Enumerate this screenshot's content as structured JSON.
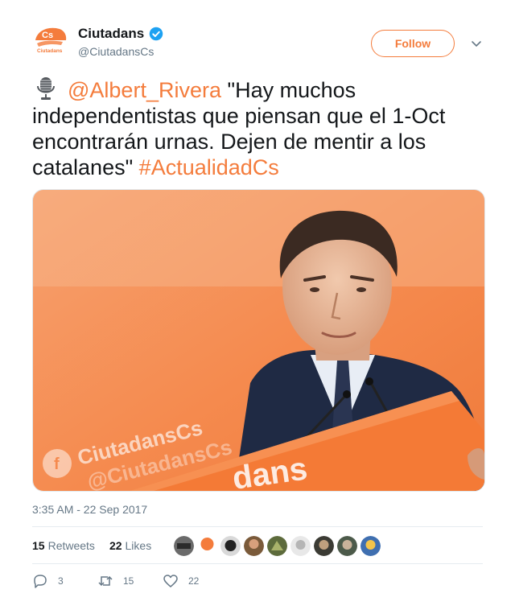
{
  "account": {
    "display_name": "Ciutadans",
    "handle": "@CiutadansCs",
    "avatar_text": "Cs",
    "avatar_subtext": "Ciutadans"
  },
  "follow_label": "Follow",
  "tweet": {
    "mention": "@Albert_Rivera",
    "text": " \"Hay muchos independentistas que piensan que el 1-Oct encontrarán urnas. Dejen de mentir a los catalanes\" ",
    "hashtag": "#ActualidadCs"
  },
  "media": {
    "banner_text_1": "CiutadansCs",
    "banner_text_2": "@CiutadansCs",
    "podium_text": "dans"
  },
  "timestamp": "3:35 AM - 22 Sep 2017",
  "stats": {
    "retweets_count": "15",
    "retweets_label": "Retweets",
    "likes_count": "22",
    "likes_label": "Likes"
  },
  "actions": {
    "replies": "3",
    "retweets": "15",
    "likes": "22"
  },
  "colors": {
    "accent": "#f47c3c",
    "verified": "#1da1f2",
    "muted": "#657786"
  },
  "icons": [
    "microphone-icon",
    "verified-icon",
    "chevron-down-icon",
    "reply-icon",
    "retweet-icon",
    "like-icon"
  ]
}
